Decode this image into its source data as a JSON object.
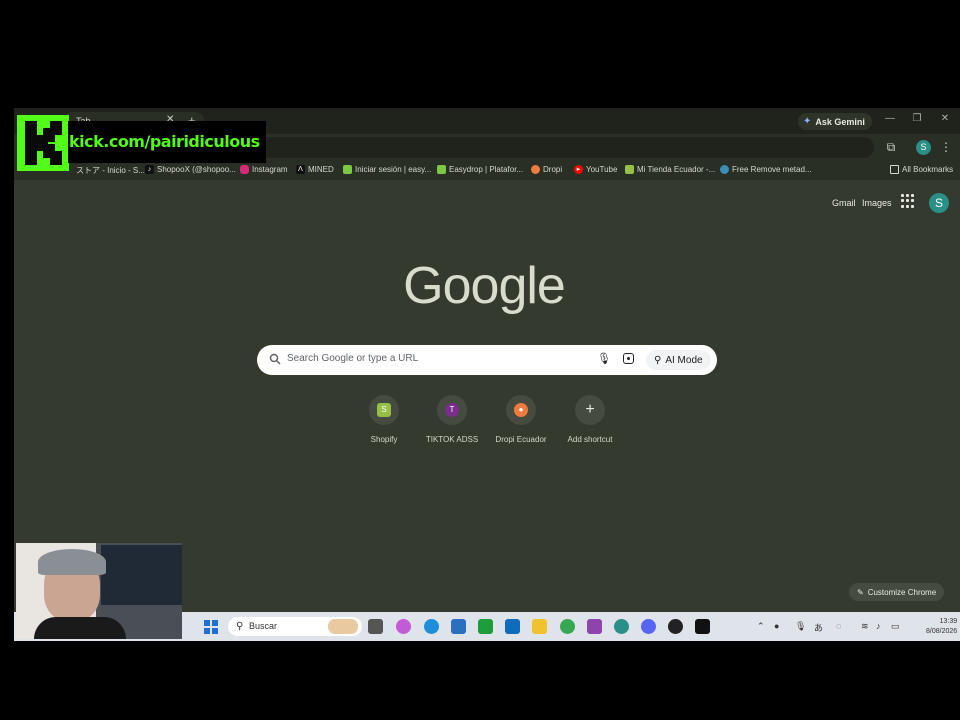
{
  "window": {
    "tab_title": "Tab",
    "tab_close_icon": "close-icon",
    "new_tab_icon": "plus-icon",
    "gemini_label": "Ask Gemini",
    "minimize_icon": "minimize-icon",
    "maximize_icon": "restore-icon",
    "close_icon": "close-icon"
  },
  "toolbar": {
    "extensions_icon": "puzzle-icon",
    "profile_initial": "S",
    "menu_icon": "kebab-menu-icon"
  },
  "bookmarks": {
    "items": [
      {
        "label": "ストア - Inicio - S...",
        "color": "#e8a33a",
        "glyph": ""
      },
      {
        "label": "ShopooX (@shopoo...",
        "color": "#111111",
        "glyph": "♪"
      },
      {
        "label": "Instagram",
        "color": "#d62976",
        "glyph": ""
      },
      {
        "label": "MINED",
        "color": "#111111",
        "glyph": "Λ"
      },
      {
        "label": "Iniciar sesión | easy...",
        "color": "#7ac943",
        "glyph": ""
      },
      {
        "label": "Easydrop | Platafor...",
        "color": "#7ac943",
        "glyph": ""
      },
      {
        "label": "Dropi",
        "color": "#f07b3f",
        "glyph": ""
      },
      {
        "label": "YouTube",
        "color": "#ff0000",
        "glyph": "▸"
      },
      {
        "label": "Mi Tienda Ecuador -...",
        "color": "#95bf47",
        "glyph": ""
      },
      {
        "label": "Free Remove metad...",
        "color": "#3a8fb7",
        "glyph": ""
      }
    ],
    "all_bookmarks": "All Bookmarks"
  },
  "ntp": {
    "gmail": "Gmail",
    "images": "Images",
    "profile_initial": "S",
    "logo": "Google",
    "search_placeholder": "Search Google or type a URL",
    "ai_mode": "AI Mode",
    "shortcuts": [
      {
        "label": "Shopify",
        "color": "#95bf47",
        "glyph": "S"
      },
      {
        "label": "TIKTOK ADSS",
        "color": "#7b2d8e",
        "glyph": "T"
      },
      {
        "label": "Dropi Ecuador",
        "color": "#f07b3f",
        "glyph": "●"
      },
      {
        "label": "Add shortcut",
        "color": "",
        "glyph": "+"
      }
    ],
    "customize": "Customize Chrome"
  },
  "taskbar": {
    "search_label": "Buscar",
    "apps": [
      {
        "name": "task-view",
        "color": "#555555"
      },
      {
        "name": "copilot",
        "color": "#c45bd6"
      },
      {
        "name": "edge",
        "color": "#1c8fd8"
      },
      {
        "name": "store",
        "color": "#2c6fbf"
      },
      {
        "name": "xbox",
        "color": "#1e9e3a"
      },
      {
        "name": "outlook",
        "color": "#0f6cbd"
      },
      {
        "name": "explorer",
        "color": "#f2c22e"
      },
      {
        "name": "chrome",
        "color": "#34a853"
      },
      {
        "name": "photos",
        "color": "#8e44ad"
      },
      {
        "name": "chrome-active",
        "color": "#2a8f86"
      },
      {
        "name": "discord",
        "color": "#5865f2"
      },
      {
        "name": "obs",
        "color": "#222222"
      },
      {
        "name": "capcut",
        "color": "#111111"
      }
    ],
    "tray_ime": "あ",
    "time": "13:39",
    "date": "8/08/2026"
  },
  "overlay": {
    "kick_text": "kick.com/pairidiculous"
  }
}
